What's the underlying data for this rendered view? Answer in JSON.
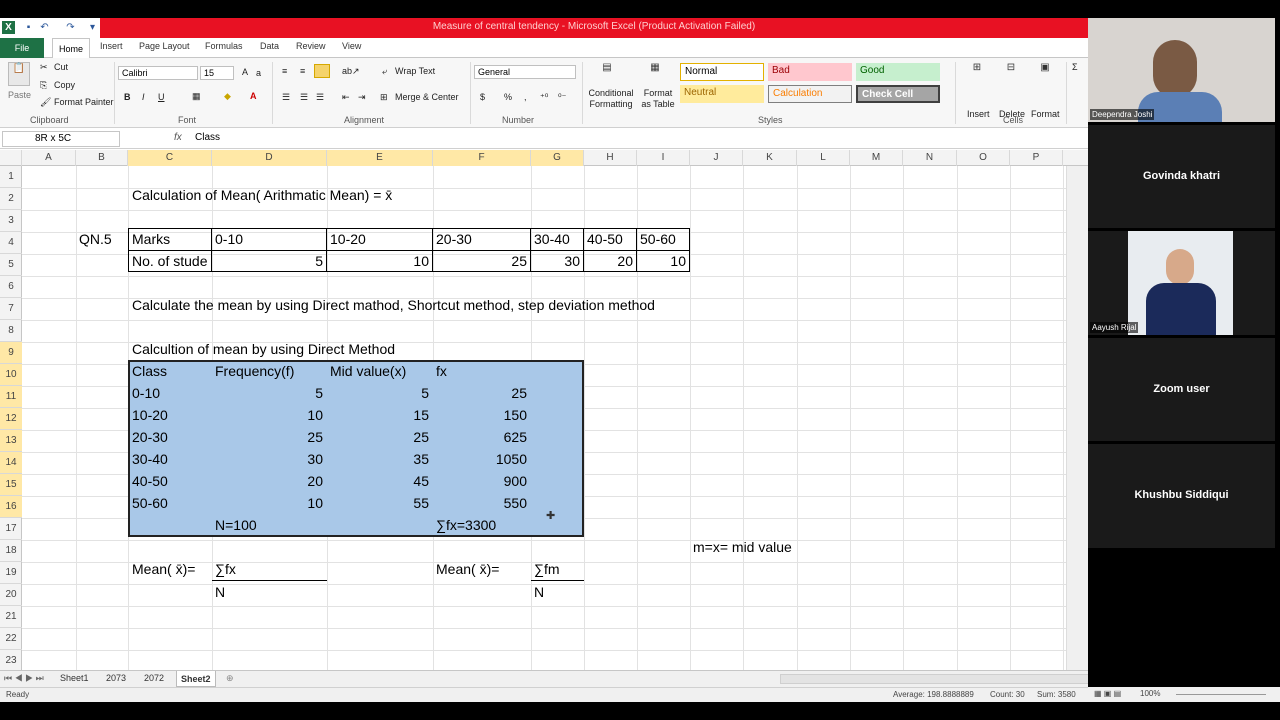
{
  "window": {
    "title": "Measure of central tendency  -  Microsoft Excel (Product Activation Failed)"
  },
  "ribbon_tabs": [
    "File",
    "Home",
    "Insert",
    "Page Layout",
    "Formulas",
    "Data",
    "Review",
    "View"
  ],
  "ribbon": {
    "clipboard": {
      "paste": "Paste",
      "cut": "Cut",
      "copy": "Copy",
      "format_painter": "Format Painter",
      "label": "Clipboard"
    },
    "font": {
      "name": "Calibri",
      "size": "15",
      "label": "Font",
      "bold": "B",
      "italic": "I",
      "underline": "U"
    },
    "alignment": {
      "wrap_text": "Wrap Text",
      "merge_center": "Merge & Center",
      "label": "Alignment"
    },
    "number": {
      "format": "General",
      "label": "Number",
      "currency": "$",
      "percent": "%",
      "comma": ","
    },
    "styles": {
      "conditional_formatting": "Conditional Formatting",
      "format_as_table": "Format as Table",
      "normal": "Normal",
      "bad": "Bad",
      "good": "Good",
      "neutral": "Neutral",
      "calculation": "Calculation",
      "check_cell": "Check Cell",
      "label": "Styles"
    },
    "cells": {
      "insert": "Insert",
      "delete": "Delete",
      "format": "Format",
      "label": "Cells"
    }
  },
  "formula_bar": {
    "name_box": "8R x 5C",
    "fx": "fx",
    "content": "Class"
  },
  "columns": [
    "A",
    "B",
    "C",
    "D",
    "E",
    "F",
    "G",
    "H",
    "I",
    "J",
    "K",
    "L",
    "M",
    "N",
    "O",
    "P"
  ],
  "rows": [
    "1",
    "2",
    "3",
    "4",
    "5",
    "6",
    "7",
    "8",
    "9",
    "10",
    "11",
    "12",
    "13",
    "14",
    "15",
    "16",
    "17",
    "18",
    "19",
    "20",
    "21",
    "22",
    "23"
  ],
  "cells": {
    "c1": "Calculation of Mean( Arithmatic Mean) = x̄",
    "b3": "QN.5",
    "c3": "Marks",
    "d3": "0-10",
    "e3": "10-20",
    "f3": "20-30",
    "g3": "30-40",
    "h3": "40-50",
    "i3": "50-60",
    "c4": "No. of stude",
    "d4": "5",
    "e4": "10",
    "f4": "25",
    "g4": "30",
    "h4": "20",
    "i4": "10",
    "c6": "Calculate the mean by using Direct mathod, Shortcut method, step deviation method",
    "c8": "Calcultion of mean by using Direct Method",
    "c9": "Class",
    "d9": "Frequency(f)",
    "e9": "Mid value(x)",
    "f9": "fx",
    "c10": "0-10",
    "d10": "5",
    "e10": "5",
    "f10": "25",
    "c11": "10-20",
    "d11": "10",
    "e11": "15",
    "f11": "150",
    "c12": "20-30",
    "d12": "25",
    "e12": "25",
    "f12": "625",
    "c13": "30-40",
    "d13": "30",
    "e13": "35",
    "f13": "1050",
    "c14": "40-50",
    "d14": "20",
    "e14": "45",
    "f14": "900",
    "c15": "50-60",
    "d15": "10",
    "e15": "55",
    "f15": "550",
    "d16": "N=100",
    "f16": "∑fx=3300",
    "j17": "m=x= mid value",
    "c18": "Mean( x̄)=",
    "d18": "∑fx",
    "f18": "Mean( x̄)=",
    "g18": "∑fm",
    "d19": "N",
    "g19": "N"
  },
  "sheet_tabs": [
    "Sheet1",
    "2073",
    "2072",
    "Sheet2"
  ],
  "status": {
    "ready": "Ready",
    "average": "Average: 198.8888889",
    "count": "Count: 30",
    "sum": "Sum: 3580",
    "zoom": "100%"
  },
  "participants": [
    {
      "name": "Deependra Joshi"
    },
    {
      "name": "Govinda khatri"
    },
    {
      "name": "Aayush Rijal"
    },
    {
      "name": "Zoom user"
    },
    {
      "name": "Khushbu Siddiqui"
    }
  ]
}
